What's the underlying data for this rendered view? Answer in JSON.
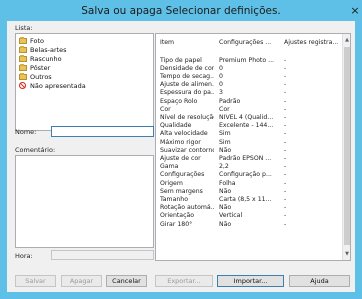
{
  "window": {
    "title": "Salva ou apaga Selecionar definições.",
    "close_label": "×"
  },
  "list": {
    "label": "Lista:",
    "items": [
      {
        "label": "Foto",
        "icon": "folder-icon"
      },
      {
        "label": "Belas-artes",
        "icon": "folder-icon"
      },
      {
        "label": "Rascunho",
        "icon": "folder-icon"
      },
      {
        "label": "Pôster",
        "icon": "folder-icon"
      },
      {
        "label": "Outros",
        "icon": "folder-icon"
      },
      {
        "label": "Não apresentada",
        "icon": "prohibited-icon"
      }
    ]
  },
  "name": {
    "label": "Nome:",
    "value": ""
  },
  "comment": {
    "label": "Comentário:",
    "value": ""
  },
  "time": {
    "label": "Hora:",
    "value": ""
  },
  "settings": {
    "columns": [
      "Item",
      "Configurações ...",
      "Ajustes registra..."
    ],
    "rows": [
      [
        "Tipo de papel",
        "Premium Photo ...",
        "-"
      ],
      [
        "Densidade de cor",
        "0",
        "-"
      ],
      [
        "Tempo de secag...",
        "0",
        "-"
      ],
      [
        "Ajuste de alimen...",
        "0",
        "-"
      ],
      [
        "Espessura do pa...",
        "3",
        "-"
      ],
      [
        "Espaço Rolo",
        "Padrão",
        "-"
      ],
      [
        "Cor",
        "Cor",
        "-"
      ],
      [
        "Nível de resolução",
        "NÍVEL 4 (Qualid...",
        "-"
      ],
      [
        "Qualidade",
        "Excelente - 144...",
        "-"
      ],
      [
        "Alta velocidade",
        "Sim",
        "-"
      ],
      [
        "Máximo rigor",
        "Sim",
        "-"
      ],
      [
        "Suavizar contornos",
        "Não",
        "-"
      ],
      [
        "Ajuste de cor",
        "Padrão EPSON ...",
        "-"
      ],
      [
        "Gama",
        "2,2",
        "-"
      ],
      [
        "Configurações",
        "Configuração p...",
        "-"
      ],
      [
        "Origem",
        "Folha",
        "-"
      ],
      [
        "Sem margens",
        "Não",
        "-"
      ],
      [
        "Tamanho",
        "Carta (8,5 x 11...",
        "-"
      ],
      [
        "Rotação automá...",
        "Não",
        "-"
      ],
      [
        "Orientação",
        "Vertical",
        "-"
      ],
      [
        "Girar 180°",
        "Não",
        "-"
      ]
    ]
  },
  "buttons": {
    "save": "Salvar",
    "delete": "Apagar",
    "cancel": "Cancelar",
    "export": "Exportar...",
    "import": "Importar...",
    "help": "Ajuda"
  }
}
